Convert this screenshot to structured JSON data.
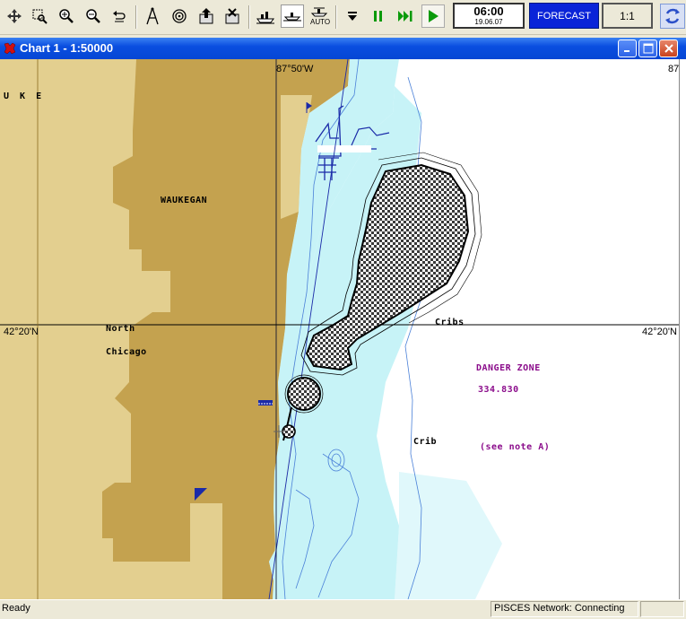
{
  "toolbar": {
    "buttons": [
      {
        "name": "pan-icon"
      },
      {
        "name": "zoom-window-icon"
      },
      {
        "name": "zoom-in-icon"
      },
      {
        "name": "zoom-out-icon"
      },
      {
        "name": "undo-zoom-icon"
      },
      {
        "name": "compass-icon"
      },
      {
        "name": "target-icon"
      },
      {
        "name": "export-icon"
      },
      {
        "name": "import-icon"
      },
      {
        "name": "ship-icon"
      },
      {
        "name": "ship-waterline-icon"
      },
      {
        "name": "auto-ship-icon"
      },
      {
        "name": "stop-icon"
      },
      {
        "name": "pause-icon"
      },
      {
        "name": "fast-forward-icon"
      },
      {
        "name": "play-icon"
      }
    ],
    "auto_label": "AUTO",
    "clock_time": "06:00",
    "clock_date": "19.06.07",
    "forecast_label": "FORECAST",
    "scale_label": "1:1",
    "accent": "#0a24d8"
  },
  "window": {
    "title": "Chart 1 - 1:50000"
  },
  "chart": {
    "top_longitude": "87°50'W",
    "left_latitude": "42°20'N",
    "right_latitude": "42°20'N",
    "edge_label_top_left": "U K E",
    "edge_label_right": "87",
    "place_waukegan": "WAUKEGAN",
    "place_north": "North",
    "place_chicago": "Chicago",
    "feature_cribs": "Cribs",
    "feature_crib": "Crib",
    "danger_zone_title": "DANGER ZONE",
    "danger_zone_code": "334.830",
    "danger_zone_note": "(see note A)",
    "colors": {
      "land_dark": "#c4a24f",
      "land_light": "#e3cf8f",
      "shallow_water": "#c7f3f7",
      "deep_water": "#ffffff",
      "text_magenta": "#8b0c8b"
    }
  },
  "statusbar": {
    "left_text": "Ready",
    "network_text": "PISCES Network: Connecting"
  }
}
